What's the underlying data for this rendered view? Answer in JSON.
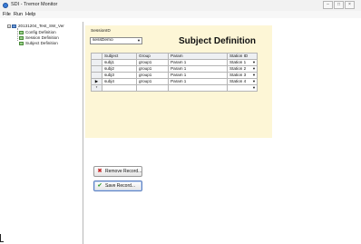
{
  "window": {
    "title": "SDI - Tremor Monitor",
    "controls": {
      "minimize": "–",
      "maximize": "□",
      "close": "×"
    }
  },
  "menu": {
    "items": [
      "File",
      "Run",
      "Help"
    ]
  },
  "tree": {
    "root": {
      "label": "20131204_Test_SW_Ver",
      "expander": "−"
    },
    "children": [
      "Config Definition",
      "Session Definition",
      "Subject Definition"
    ]
  },
  "session": {
    "label": "SessionID",
    "selected": "sessDemo",
    "arrow": "▼"
  },
  "page": {
    "title": "Subject Definition"
  },
  "grid": {
    "columns": [
      "Subject",
      "Group",
      "Param",
      "Station ID"
    ],
    "rows": [
      {
        "marker": "",
        "subject": "subj1",
        "group": "group1",
        "param": "Param 1",
        "station": "Station 1"
      },
      {
        "marker": "",
        "subject": "subj2",
        "group": "group1",
        "param": "Param 1",
        "station": "Station 2"
      },
      {
        "marker": "",
        "subject": "subj3",
        "group": "group1",
        "param": "Param 1",
        "station": "Station 3"
      },
      {
        "marker": "▶",
        "subject": "subj4",
        "group": "group1",
        "param": "Param 1",
        "station": "Station 4"
      }
    ],
    "new_row_marker": "*",
    "dropdown_arrow": "▼"
  },
  "buttons": {
    "remove": {
      "label": "Remove Record...",
      "icon": "remove-icon"
    },
    "save": {
      "label": "Save Record...",
      "icon": "check-icon"
    }
  },
  "colors": {
    "form_background": "#fdf6d6",
    "accent": "#3b7dd8"
  }
}
